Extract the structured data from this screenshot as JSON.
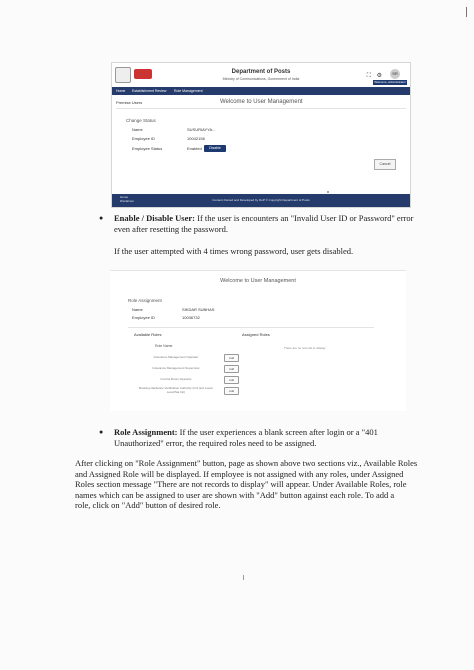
{
  "screenshot1": {
    "dept_title": "Department of Posts",
    "dept_subtitle": "Ministry of Communications, Government of India",
    "header_icons": "⛶ ⚙",
    "avatar": "SR",
    "user_bar": "Welcome, Administrator",
    "nav": [
      "Home",
      "Establishment Review",
      "Role Management"
    ],
    "side_label": "Premise Users",
    "welcome": "Welcome to User Management",
    "change_status": "Change Status",
    "fields": [
      {
        "label": "Name",
        "value": "SUSURIAYYA..."
      },
      {
        "label": "Employee ID",
        "value": "10042156"
      },
      {
        "label": "Employee Status",
        "value": "Enabled"
      }
    ],
    "disable_button": "Disable",
    "cancel_button": "Cancel",
    "footer_left": "Home\nDisclaimer",
    "footer_center": "Content Owned and Developed by DoP © Copyright Department of Posts"
  },
  "bullet1": {
    "heading": "Enable / Disable User:",
    "text_line1": " If the user is encounters an \"Invalid User ID or Password\" error",
    "text_line2": "even after resetting the password."
  },
  "para1": "If the user attempted with 4 times wrong password, user gets disabled.",
  "screenshot2": {
    "welcome": "Welcome to User Management",
    "role_assignment": "Role Assignment",
    "fields": [
      {
        "label": "Name",
        "value": "SIKDAR SUBHAS"
      },
      {
        "label": "Employee ID",
        "value": "10036732"
      }
    ],
    "available_roles": "Available Roles",
    "assigned_roles": "Assigned Roles",
    "role_name": "Role Name",
    "no_records": "There are no records to display",
    "roles": [
      "Grievance Management Operator",
      "Grievance Management Supervisor",
      "Control Room Operator",
      "Booking Hardware Verification Authority (Incl and Lower Level/Sat Op)"
    ],
    "add_label": "Add"
  },
  "bullet2": {
    "heading": "Role Assignment:",
    "text_line1": " If the user experiences a blank screen after login or a \"401",
    "text_line2": "Unauthorized\" error, the required roles need to be assigned."
  },
  "para2": [
    "After clicking on \"Role Assignment\" button, page as shown above two sections viz., Available Roles",
    "and Assigned Role will be displayed.  If employee is not assigned with any roles, under Assigned",
    "Roles section message \"There are not records to display\" will appear.  Under Available Roles, role",
    "names which can be assigned to user are shown with \"Add\" button against each role.     To add a",
    "role, click on \"Add\" button of desired role."
  ]
}
